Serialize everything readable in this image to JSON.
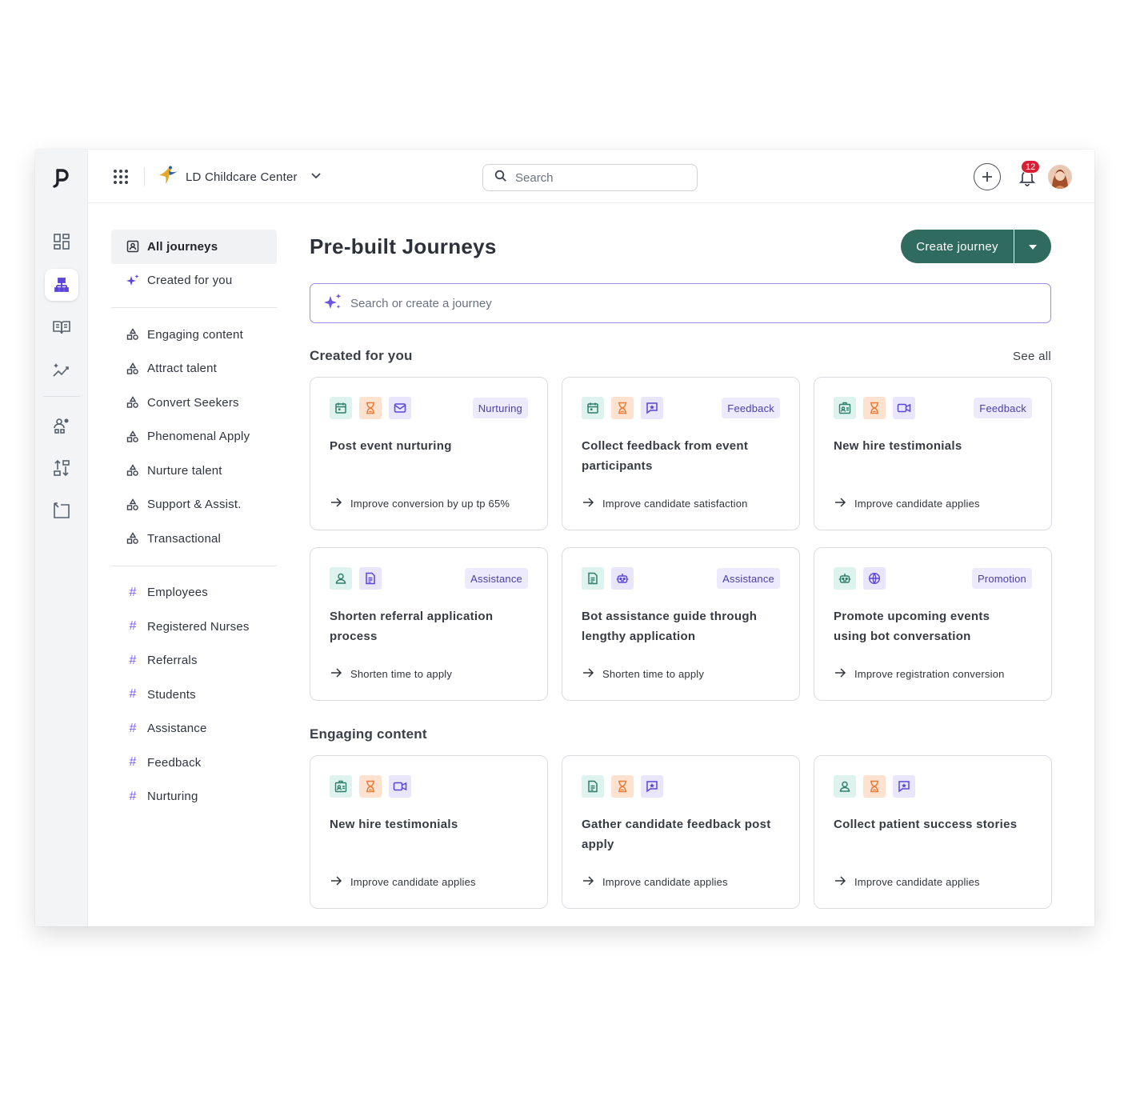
{
  "topbar": {
    "org_name": "LD Childcare Center",
    "search_placeholder": "Search",
    "notification_count": "12"
  },
  "nav": {
    "primary": [
      {
        "label": "All journeys",
        "icon": "journeys-icon",
        "active": true
      },
      {
        "label": "Created for you",
        "icon": "sparkle-icon"
      }
    ],
    "categories": [
      {
        "label": "Engaging content"
      },
      {
        "label": "Attract talent"
      },
      {
        "label": "Convert Seekers"
      },
      {
        "label": "Phenomenal Apply"
      },
      {
        "label": "Nurture talent"
      },
      {
        "label": "Support & Assist."
      },
      {
        "label": "Transactional"
      }
    ],
    "tags": [
      {
        "label": "Employees"
      },
      {
        "label": "Registered Nurses"
      },
      {
        "label": "Referrals"
      },
      {
        "label": "Students"
      },
      {
        "label": "Assistance"
      },
      {
        "label": "Feedback"
      },
      {
        "label": "Nurturing"
      }
    ],
    "hash_symbol": "#"
  },
  "main": {
    "title": "Pre-built Journeys",
    "create_label": "Create journey",
    "ai_search_placeholder": "Search or create a journey",
    "section1_title": "Created for you",
    "see_all": "See all",
    "section2_title": "Engaging content"
  },
  "created_cards": [
    {
      "icons": [
        "calendar",
        "hourglass",
        "mail"
      ],
      "tag": "Nurturing",
      "title": "Post event nurturing",
      "goal": "Improve conversion by up tp 65%"
    },
    {
      "icons": [
        "calendar",
        "hourglass",
        "message-star"
      ],
      "tag": "Feedback",
      "title": "Collect feedback from event participants",
      "goal": "Improve candidate satisfaction"
    },
    {
      "icons": [
        "id-card",
        "hourglass",
        "video"
      ],
      "tag": "Feedback",
      "title": "New hire testimonials",
      "goal": "Improve candidate applies"
    },
    {
      "icons": [
        "user",
        "document"
      ],
      "tag": "Assistance",
      "title": "Shorten referral application process",
      "goal": "Shorten time to apply"
    },
    {
      "icons": [
        "document",
        "bot"
      ],
      "tag": "Assistance",
      "title": "Bot assistance guide through lengthy application",
      "goal": "Shorten time to apply"
    },
    {
      "icons": [
        "bot",
        "globe"
      ],
      "tag": "Promotion",
      "title": "Promote upcoming events using bot conversation",
      "goal": "Improve registration conversion"
    }
  ],
  "engaging_cards": [
    {
      "icons": [
        "id-card",
        "hourglass",
        "video"
      ],
      "title": "New hire testimonials",
      "goal": "Improve candidate applies"
    },
    {
      "icons": [
        "document",
        "hourglass",
        "message-star"
      ],
      "title": "Gather candidate feedback post apply",
      "goal": "Improve candidate applies"
    },
    {
      "icons": [
        "user",
        "hourglass",
        "message-star"
      ],
      "title": "Collect patient success stories",
      "goal": "Improve candidate applies"
    }
  ],
  "colors": {
    "brand_green": "#2f6b5e",
    "accent_purple": "#7b61ff",
    "notification_red": "#d72034",
    "icon_green": "#2f7d6b",
    "icon_orange": "#ee7b3a",
    "icon_purple": "#5b45d6"
  }
}
